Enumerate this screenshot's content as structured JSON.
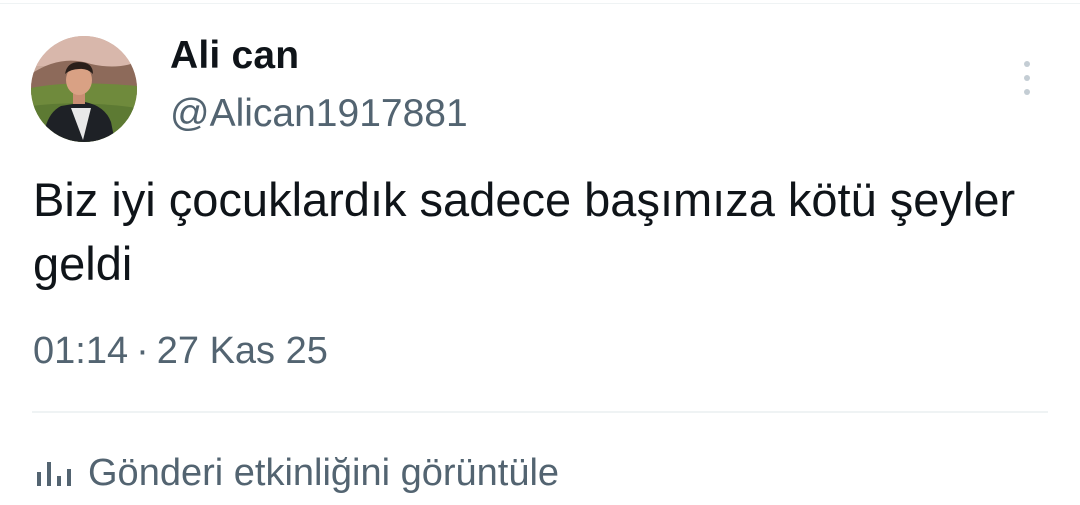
{
  "tweet": {
    "author": {
      "display_name": "Ali can",
      "handle": "@Alican1917881"
    },
    "text": "Biz iyi çocuklardık sadece başımıza kötü şeyler geldi",
    "time": "01:14",
    "separator": "·",
    "date": "27 Kas 25"
  },
  "actions": {
    "view_activity_label": "Gönderi etkinliğini görüntüle",
    "view_activity_icon": "bar-chart-icon",
    "more_icon": "more-vertical-icon"
  },
  "colors": {
    "text_primary": "#0f1419",
    "text_secondary": "#536471",
    "divider": "#eff3f4"
  }
}
